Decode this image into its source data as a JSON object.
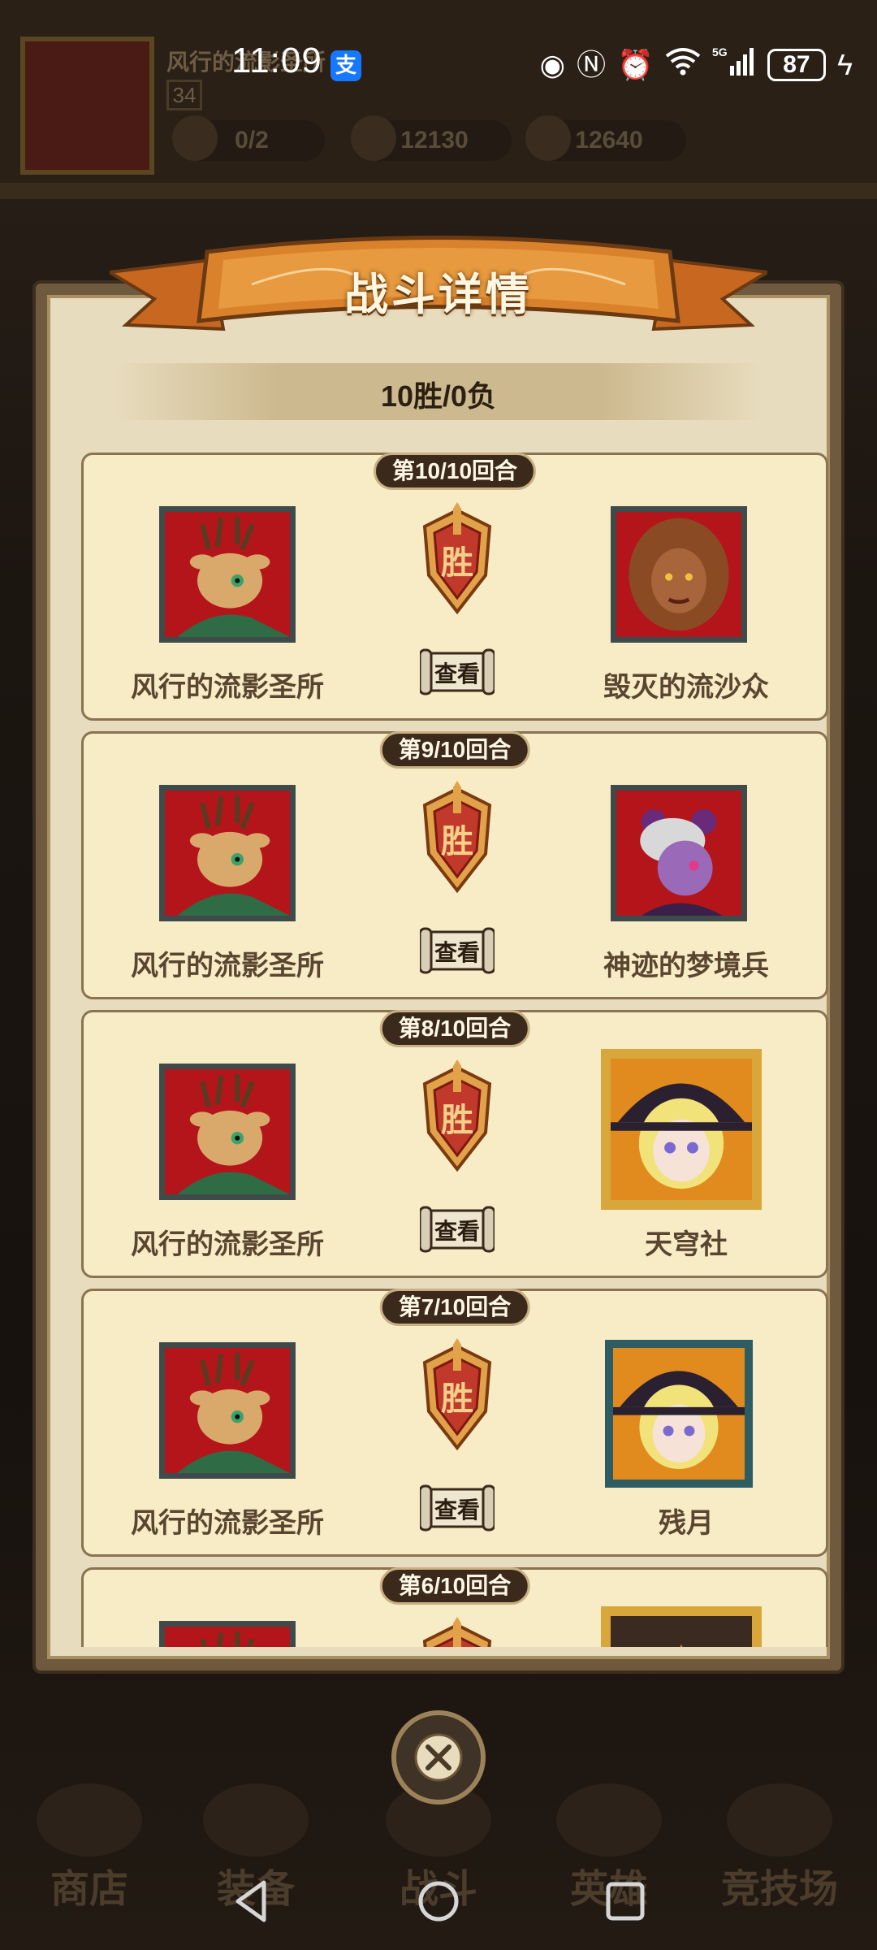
{
  "status_bar": {
    "time": "11:09",
    "pay_icon": "支",
    "network": "5G",
    "battery": "87"
  },
  "background": {
    "player_name": "风行的流影圣所",
    "level": "34",
    "stamina": "0/2",
    "gems": "12130",
    "gold": "12640",
    "nav": [
      "商店",
      "装备",
      "战斗",
      "英雄",
      "竞技场"
    ]
  },
  "dialog": {
    "title": "战斗详情",
    "record": "10胜/0负",
    "win_label": "胜",
    "view_label": "查看",
    "rounds": [
      {
        "round": "第10/10回合",
        "left_name": "风行的流影圣所",
        "right_name": "毁灭的流沙众",
        "right_portrait": "lion-warrior",
        "frame": "dark"
      },
      {
        "round": "第9/10回合",
        "left_name": "风行的流影圣所",
        "right_name": "神迹的梦境兵",
        "right_portrait": "mummy-girl",
        "frame": "dark"
      },
      {
        "round": "第8/10回合",
        "left_name": "风行的流影圣所",
        "right_name": "天穹社",
        "right_portrait": "witch-girl",
        "frame": "gold"
      },
      {
        "round": "第7/10回合",
        "left_name": "风行的流影圣所",
        "right_name": "残月",
        "right_portrait": "witch-girl",
        "frame": "teal"
      },
      {
        "round": "第6/10回合",
        "left_name": "",
        "right_name": "",
        "right_portrait": "dragon",
        "frame": "gold"
      }
    ]
  },
  "colors": {
    "card_bg": "#f7ecc6",
    "portrait_red": "#b3151a",
    "badge_red": "#c0392b",
    "banner_orange": "#d9822b"
  }
}
